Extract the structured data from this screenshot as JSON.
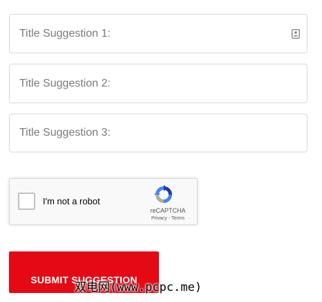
{
  "form": {
    "fields": [
      {
        "placeholder": "Title Suggestion 1:",
        "value": "",
        "trailing_icon": "contact-card-icon"
      },
      {
        "placeholder": "Title Suggestion 2:",
        "value": ""
      },
      {
        "placeholder": "Title Suggestion 3:",
        "value": ""
      }
    ],
    "recaptcha": {
      "label": "I'm not a robot",
      "brand": "reCAPTCHA",
      "privacy": "Privacy",
      "separator": " - ",
      "terms": "Terms",
      "checked": false
    },
    "submit_label": "SUBMIT SUGGESTION"
  },
  "watermark": "双电网(www.pcpc.me)",
  "colors": {
    "submit_bg": "#e50914",
    "field_border": "#d7d7d7",
    "placeholder": "#7a7a7a",
    "recaptcha_bg": "#f9f9f9"
  }
}
